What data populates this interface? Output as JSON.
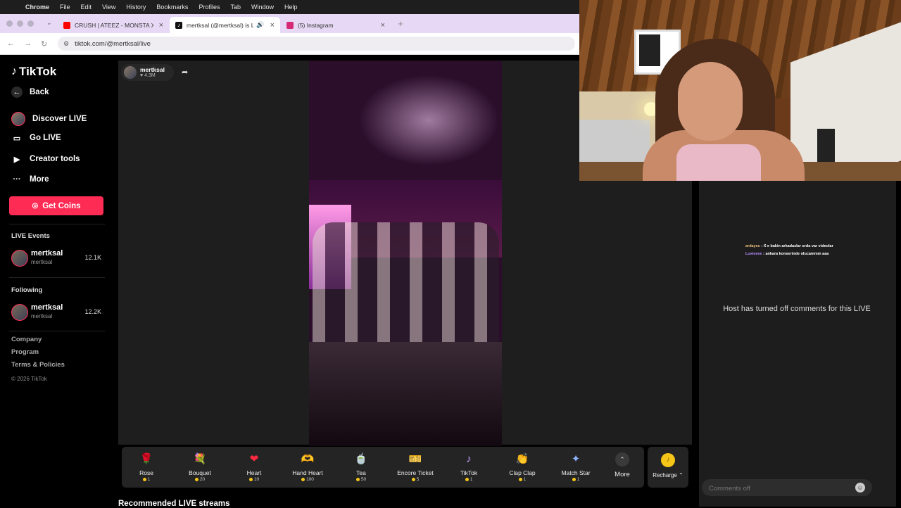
{
  "menubar": {
    "apple": "",
    "items": [
      "Chrome",
      "File",
      "Edit",
      "View",
      "History",
      "Bookmarks",
      "Profiles",
      "Tab",
      "Window",
      "Help"
    ]
  },
  "browser": {
    "tabs": [
      {
        "title": "CRUSH | ATEEZ - MONSTA X",
        "favicon_color": "#ff0000",
        "favicon": "youtube-icon"
      },
      {
        "title": "mertksal (@mertksal) is LIVE",
        "favicon_color": "#111111",
        "favicon": "tiktok-icon",
        "active": true
      },
      {
        "title": "(5) Instagram",
        "favicon_color": "#d62976",
        "favicon": "instagram-icon"
      }
    ],
    "url": "tiktok.com/@mertksal/live"
  },
  "sidebar": {
    "logo": "TikTok",
    "back": "Back",
    "nav": [
      {
        "label": "Discover LIVE",
        "icon": "discover-live-icon"
      },
      {
        "label": "Go LIVE",
        "icon": "camera-icon"
      },
      {
        "label": "Creator tools",
        "icon": "creator-tools-icon"
      },
      {
        "label": "More",
        "icon": "more-dots-icon"
      }
    ],
    "get_coins": "Get Coins",
    "live_events_title": "LIVE Events",
    "live_events": [
      {
        "name": "mertksal",
        "handle": "mertksal",
        "count": "12.1K"
      }
    ],
    "following_title": "Following",
    "following": [
      {
        "name": "mertksal",
        "handle": "mertksal",
        "count": "12.2K"
      }
    ],
    "footer": [
      "Company",
      "Program",
      "Terms & Policies"
    ],
    "copyright": "© 2026 TikTok"
  },
  "host": {
    "name": "mertksal",
    "likes": "♥ 4.3M"
  },
  "gifts": [
    {
      "name": "Rose",
      "price": "1",
      "emoji": "🌹",
      "color": "#e0334f"
    },
    {
      "name": "Bouquet",
      "price": "20",
      "emoji": "💐",
      "color": "#d96a8a"
    },
    {
      "name": "Heart",
      "price": "10",
      "emoji": "❤",
      "color": "#ff2a40"
    },
    {
      "name": "Hand Heart",
      "price": "100",
      "emoji": "🫶",
      "color": "#e8a6d6"
    },
    {
      "name": "Tea",
      "price": "50",
      "emoji": "🍵",
      "color": "#c0392b"
    },
    {
      "name": "Encore Ticket",
      "price": "5",
      "emoji": "🎫",
      "color": "#e03b3b"
    },
    {
      "name": "TikTok",
      "price": "1",
      "emoji": "♪",
      "color": "#c9a0ff"
    },
    {
      "name": "Clap Clap",
      "price": "1",
      "emoji": "👏",
      "color": "#f2b84b"
    },
    {
      "name": "Match Star",
      "price": "1",
      "emoji": "✦",
      "color": "#8fb3ff"
    }
  ],
  "more_label": "More",
  "recharge_label": "Recharge ⌃",
  "recommended_title": "Recommended LIVE streams",
  "chat": {
    "messages": [
      {
        "user": "ardaysc",
        "text": "X e bakin arkadaslar orda var videolar"
      },
      {
        "user": "Luxieeee",
        "text": "ankara konserinde olucammm aaa"
      }
    ],
    "comments_off_message": "Host has turned off comments for this LIVE",
    "input_placeholder": "Comments off"
  }
}
